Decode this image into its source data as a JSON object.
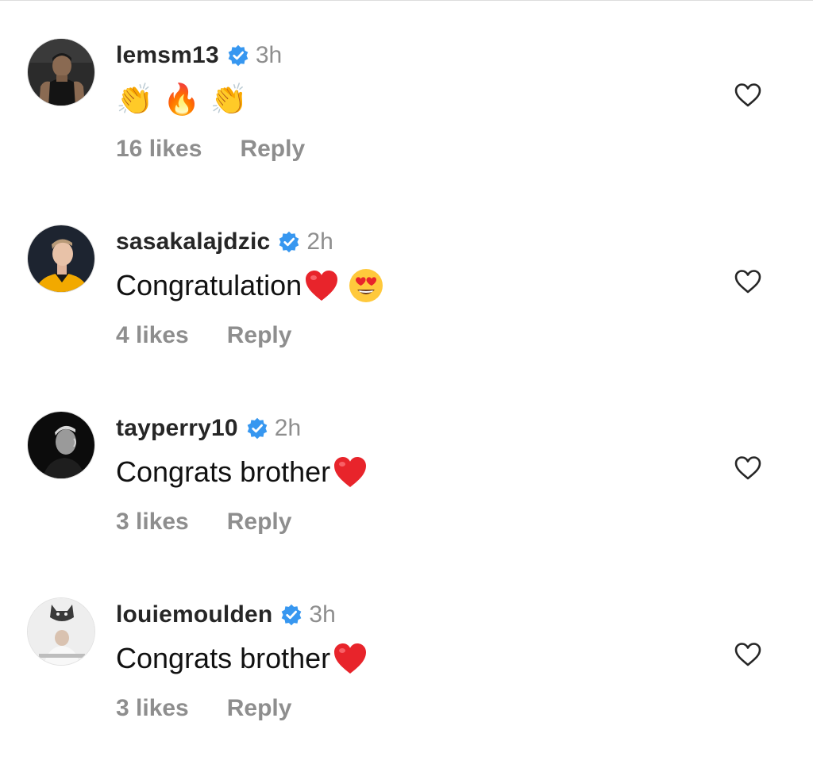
{
  "colors": {
    "username": "#262626",
    "secondary": "#8e8e8e",
    "verified_badge": "#3797f0",
    "body_text": "#111111",
    "like_outline": "#262626"
  },
  "comments": [
    {
      "username": "lemsm13",
      "verified": true,
      "time": "3h",
      "text": "",
      "emojis": [
        "👏",
        "🔥",
        "👏"
      ],
      "likes": "16 likes",
      "reply": "Reply",
      "like_icon": "heart-outline-icon"
    },
    {
      "username": "sasakalajdzic",
      "verified": true,
      "time": "2h",
      "text": "Congratulation",
      "emojis": [
        "❤️",
        "😍"
      ],
      "likes": "4 likes",
      "reply": "Reply",
      "like_icon": "heart-outline-icon"
    },
    {
      "username": "tayperry10",
      "verified": true,
      "time": "2h",
      "text": "Congrats brother",
      "emojis": [
        "❤️"
      ],
      "likes": "3 likes",
      "reply": "Reply",
      "like_icon": "heart-outline-icon"
    },
    {
      "username": "louiemoulden",
      "verified": true,
      "time": "3h",
      "text": "Congrats brother",
      "emojis": [
        "❤️"
      ],
      "likes": "3 likes",
      "reply": "Reply",
      "like_icon": "heart-outline-icon"
    }
  ]
}
